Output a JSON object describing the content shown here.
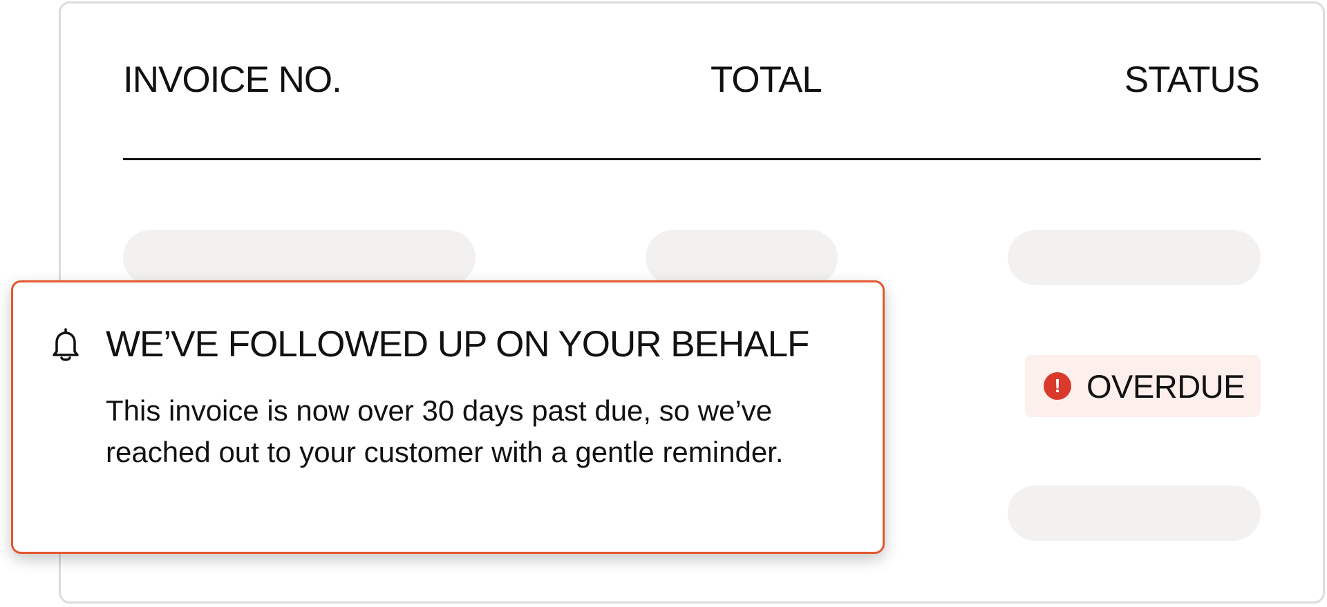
{
  "table": {
    "headers": {
      "invoice_no": "INVOICE NO.",
      "total": "TOTAL",
      "status": "STATUS"
    },
    "rows": [
      {
        "state": "loading"
      },
      {
        "state": "loading",
        "status_badge": {
          "label": "OVERDUE",
          "icon": "alert-icon",
          "icon_glyph": "!",
          "color": "#d93a2b",
          "background": "#fcefec"
        }
      },
      {
        "state": "loading"
      }
    ]
  },
  "notification": {
    "icon": "bell-icon",
    "title": "WE’VE FOLLOWED UP ON YOUR BEHALF",
    "body": "This invoice is now over 30 days past due, so we’ve reached out to your customer with a gentle reminder.",
    "border_color": "#e3562d"
  },
  "colors": {
    "skeleton": "#f2f1ef",
    "card_border": "#dcdcda",
    "text": "#111111"
  }
}
